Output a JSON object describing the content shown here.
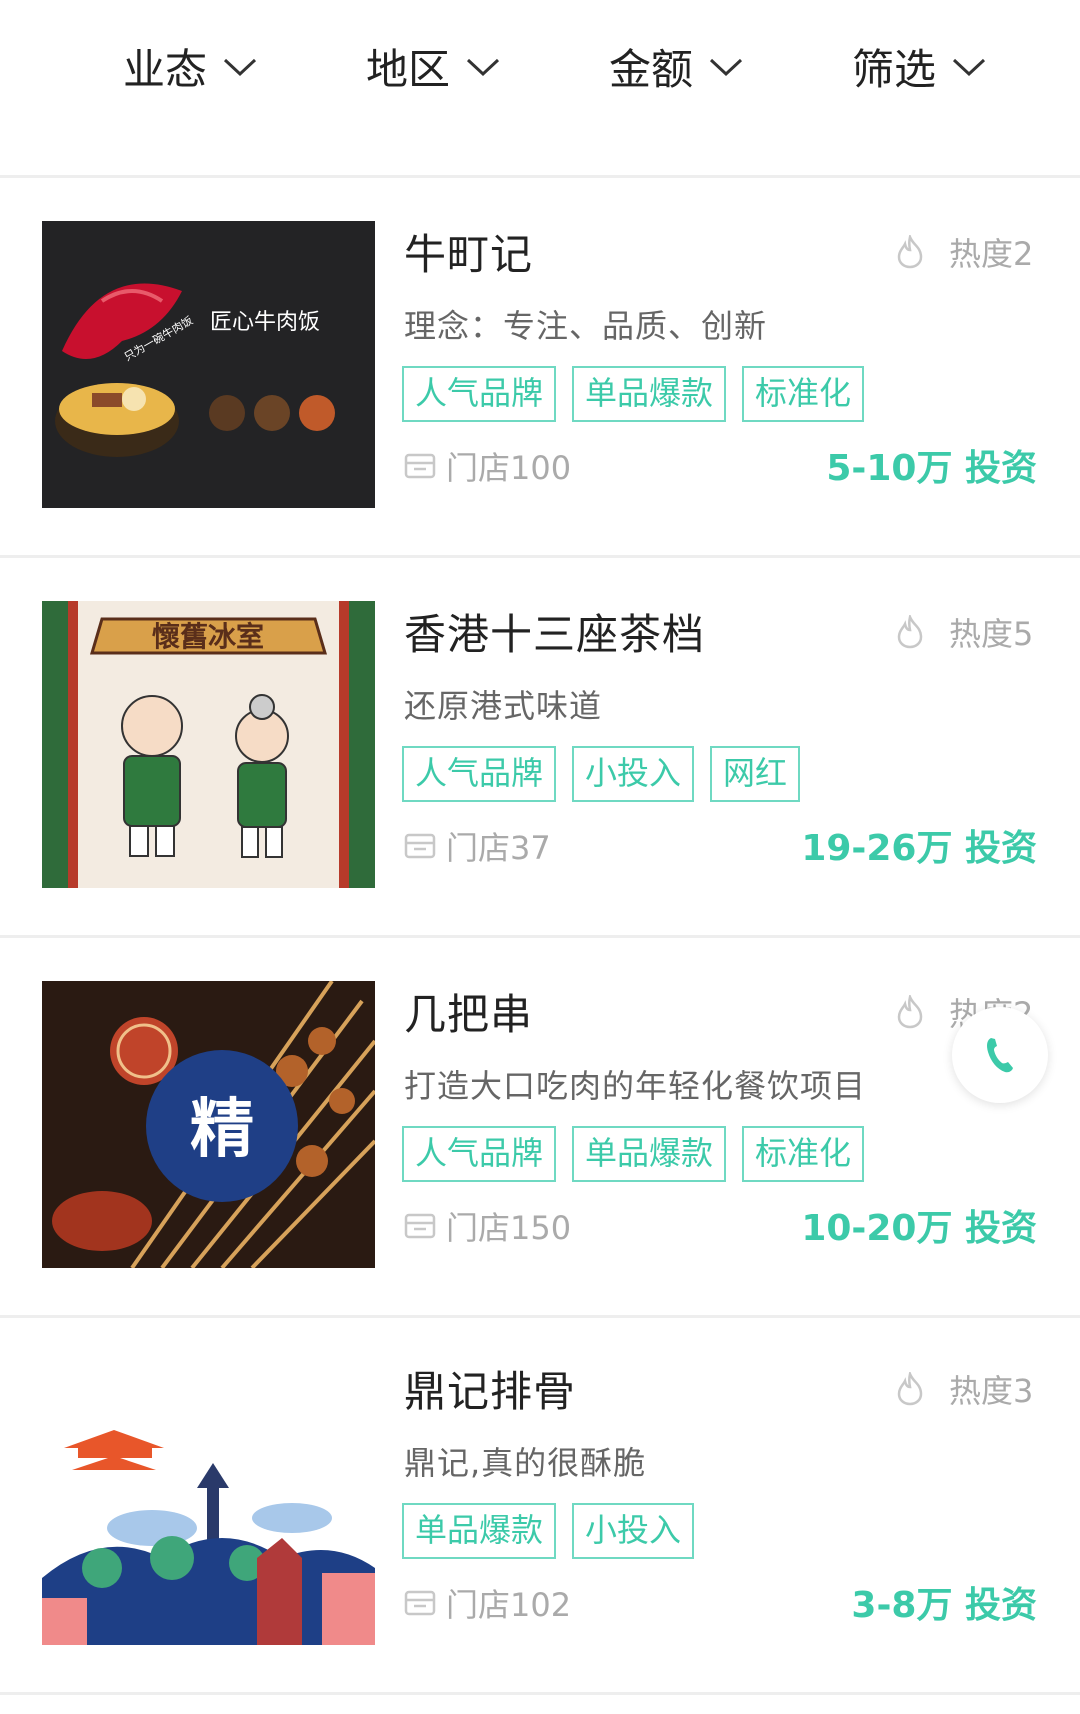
{
  "filters": [
    "业态",
    "地区",
    "金额",
    "筛选"
  ],
  "colors": {
    "accent": "#3ccaa9",
    "tag_border": "#6fd9c2",
    "muted": "#aaaaaa"
  },
  "cards": [
    {
      "name": "牛町记",
      "heat": "热度2",
      "slogan": "理念：专注、品质、创新",
      "tags": [
        "人气品牌",
        "单品爆款",
        "标准化"
      ],
      "stores": "门店100",
      "price": "5-10万 投资",
      "image": {
        "text": "匠心牛肉饭",
        "small": "只为一碗牛肉饭"
      }
    },
    {
      "name": "香港十三座茶档",
      "heat": "热度5",
      "slogan": "还原港式味道",
      "tags": [
        "人气品牌",
        "小投入",
        "网红"
      ],
      "stores": "门店37",
      "price": "19-26万 投资",
      "image": {
        "text": "懷舊冰室"
      }
    },
    {
      "name": "几把串",
      "heat": "热度2",
      "slogan": "打造大口吃肉的年轻化餐饮项目",
      "tags": [
        "人气品牌",
        "单品爆款",
        "标准化"
      ],
      "stores": "门店150",
      "price": "10-20万 投资",
      "image": {
        "text": "精"
      }
    },
    {
      "name": "鼎记排骨",
      "heat": "热度3",
      "slogan": "鼎记,真的很酥脆",
      "tags": [
        "单品爆款",
        "小投入"
      ],
      "stores": "门店102",
      "price": "3-8万 投资"
    }
  ],
  "icons": [
    "chevron-down-icon",
    "flame-icon",
    "store-icon",
    "phone-icon"
  ]
}
